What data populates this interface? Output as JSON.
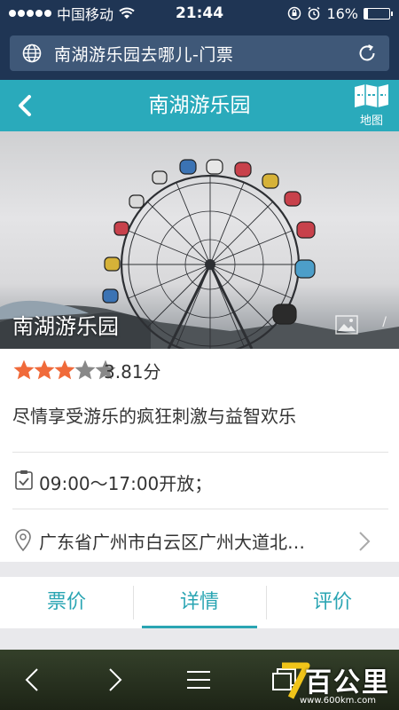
{
  "status_bar": {
    "carrier": "中国移动",
    "time": "21:44",
    "battery_percent": "16%",
    "battery_level": 0.16
  },
  "browser": {
    "url_text": "南湖游乐园去哪儿-门票"
  },
  "header": {
    "title": "南湖游乐园",
    "map_label": "地图"
  },
  "hero": {
    "name": "南湖游乐园",
    "photo_count": "/"
  },
  "info": {
    "rating_stars": 3,
    "rating_max": 5,
    "rating_text": "3.81分",
    "slogan": "尽情享受游乐的疯狂刺激与益智欢乐",
    "hours": "09:00～17:00开放；",
    "address": "广东省广州市白云区广州大道北…"
  },
  "tabs": [
    {
      "label": "票价",
      "active": false
    },
    {
      "label": "详情",
      "active": true
    },
    {
      "label": "评价",
      "active": false
    }
  ],
  "watermark": {
    "text": "百公里",
    "url": "www.600km.com"
  },
  "colors": {
    "status_bg": "#1f3554",
    "accent": "#2aaabb",
    "star_on": "#f06a3a",
    "star_off": "#888888"
  }
}
